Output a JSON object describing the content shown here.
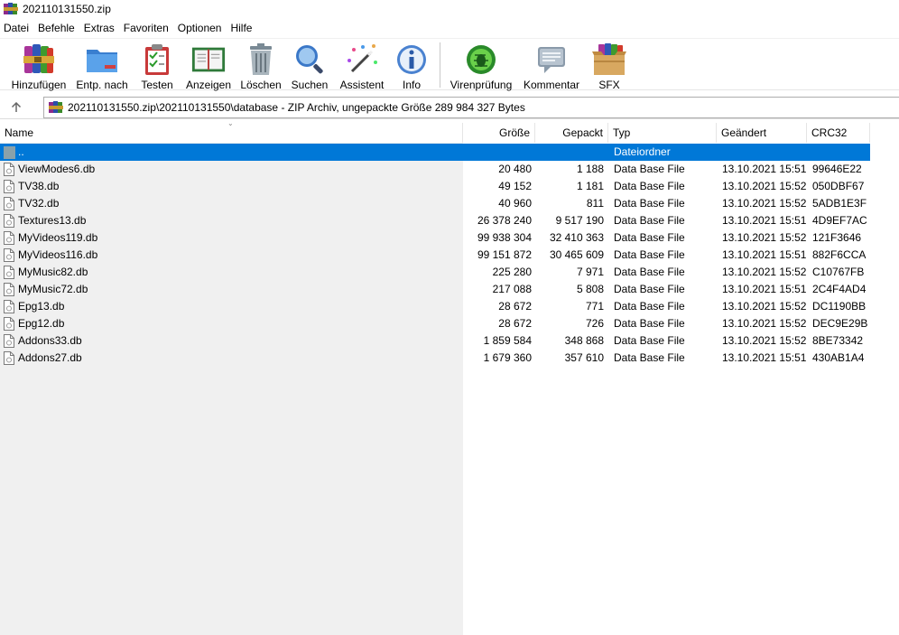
{
  "window": {
    "title": "202110131550.zip"
  },
  "menu": [
    "Datei",
    "Befehle",
    "Extras",
    "Favoriten",
    "Optionen",
    "Hilfe"
  ],
  "toolbar": [
    {
      "label": "Hinzufügen",
      "icon": "archive-books-icon"
    },
    {
      "label": "Entp. nach",
      "icon": "folder-extract-icon"
    },
    {
      "label": "Testen",
      "icon": "clipboard-check-icon"
    },
    {
      "label": "Anzeigen",
      "icon": "open-book-icon"
    },
    {
      "label": "Löschen",
      "icon": "trash-can-icon"
    },
    {
      "label": "Suchen",
      "icon": "magnifier-icon"
    },
    {
      "label": "Assistent",
      "icon": "magic-wand-icon"
    },
    {
      "label": "Info",
      "icon": "info-icon"
    },
    {
      "label": "Virenprüfung",
      "icon": "virus-scan-icon"
    },
    {
      "label": "Kommentar",
      "icon": "comment-icon"
    },
    {
      "label": "SFX",
      "icon": "sfx-box-icon"
    }
  ],
  "address": {
    "path": "202110131550.zip\\202110131550\\database - ZIP Archiv, ungepackte Größe 289 984 327 Bytes",
    "up_icon": "arrow-up-icon"
  },
  "columns": {
    "name": "Name",
    "size": "Größe",
    "packed": "Gepackt",
    "type": "Typ",
    "modified": "Geändert",
    "crc": "CRC32"
  },
  "parent_row": {
    "name": "..",
    "type": "Dateiordner"
  },
  "files": [
    {
      "name": "ViewModes6.db",
      "size": "20 480",
      "packed": "1 188",
      "type": "Data Base File",
      "modified": "13.10.2021 15:51",
      "crc": "99646E22"
    },
    {
      "name": "TV38.db",
      "size": "49 152",
      "packed": "1 181",
      "type": "Data Base File",
      "modified": "13.10.2021 15:52",
      "crc": "050DBF67"
    },
    {
      "name": "TV32.db",
      "size": "40 960",
      "packed": "811",
      "type": "Data Base File",
      "modified": "13.10.2021 15:52",
      "crc": "5ADB1E3F"
    },
    {
      "name": "Textures13.db",
      "size": "26 378 240",
      "packed": "9 517 190",
      "type": "Data Base File",
      "modified": "13.10.2021 15:51",
      "crc": "4D9EF7AC"
    },
    {
      "name": "MyVideos119.db",
      "size": "99 938 304",
      "packed": "32 410 363",
      "type": "Data Base File",
      "modified": "13.10.2021 15:52",
      "crc": "121F3646"
    },
    {
      "name": "MyVideos116.db",
      "size": "99 151 872",
      "packed": "30 465 609",
      "type": "Data Base File",
      "modified": "13.10.2021 15:51",
      "crc": "882F6CCA"
    },
    {
      "name": "MyMusic82.db",
      "size": "225 280",
      "packed": "7 971",
      "type": "Data Base File",
      "modified": "13.10.2021 15:52",
      "crc": "C10767FB"
    },
    {
      "name": "MyMusic72.db",
      "size": "217 088",
      "packed": "5 808",
      "type": "Data Base File",
      "modified": "13.10.2021 15:51",
      "crc": "2C4F4AD4"
    },
    {
      "name": "Epg13.db",
      "size": "28 672",
      "packed": "771",
      "type": "Data Base File",
      "modified": "13.10.2021 15:52",
      "crc": "DC1190BB"
    },
    {
      "name": "Epg12.db",
      "size": "28 672",
      "packed": "726",
      "type": "Data Base File",
      "modified": "13.10.2021 15:52",
      "crc": "DEC9E29B"
    },
    {
      "name": "Addons33.db",
      "size": "1 859 584",
      "packed": "348 868",
      "type": "Data Base File",
      "modified": "13.10.2021 15:52",
      "crc": "8BE73342"
    },
    {
      "name": "Addons27.db",
      "size": "1 679 360",
      "packed": "357 610",
      "type": "Data Base File",
      "modified": "13.10.2021 15:51",
      "crc": "430AB1A4"
    }
  ],
  "colors": {
    "selection": "#0078d7",
    "list_background": "#f0f0f0"
  }
}
